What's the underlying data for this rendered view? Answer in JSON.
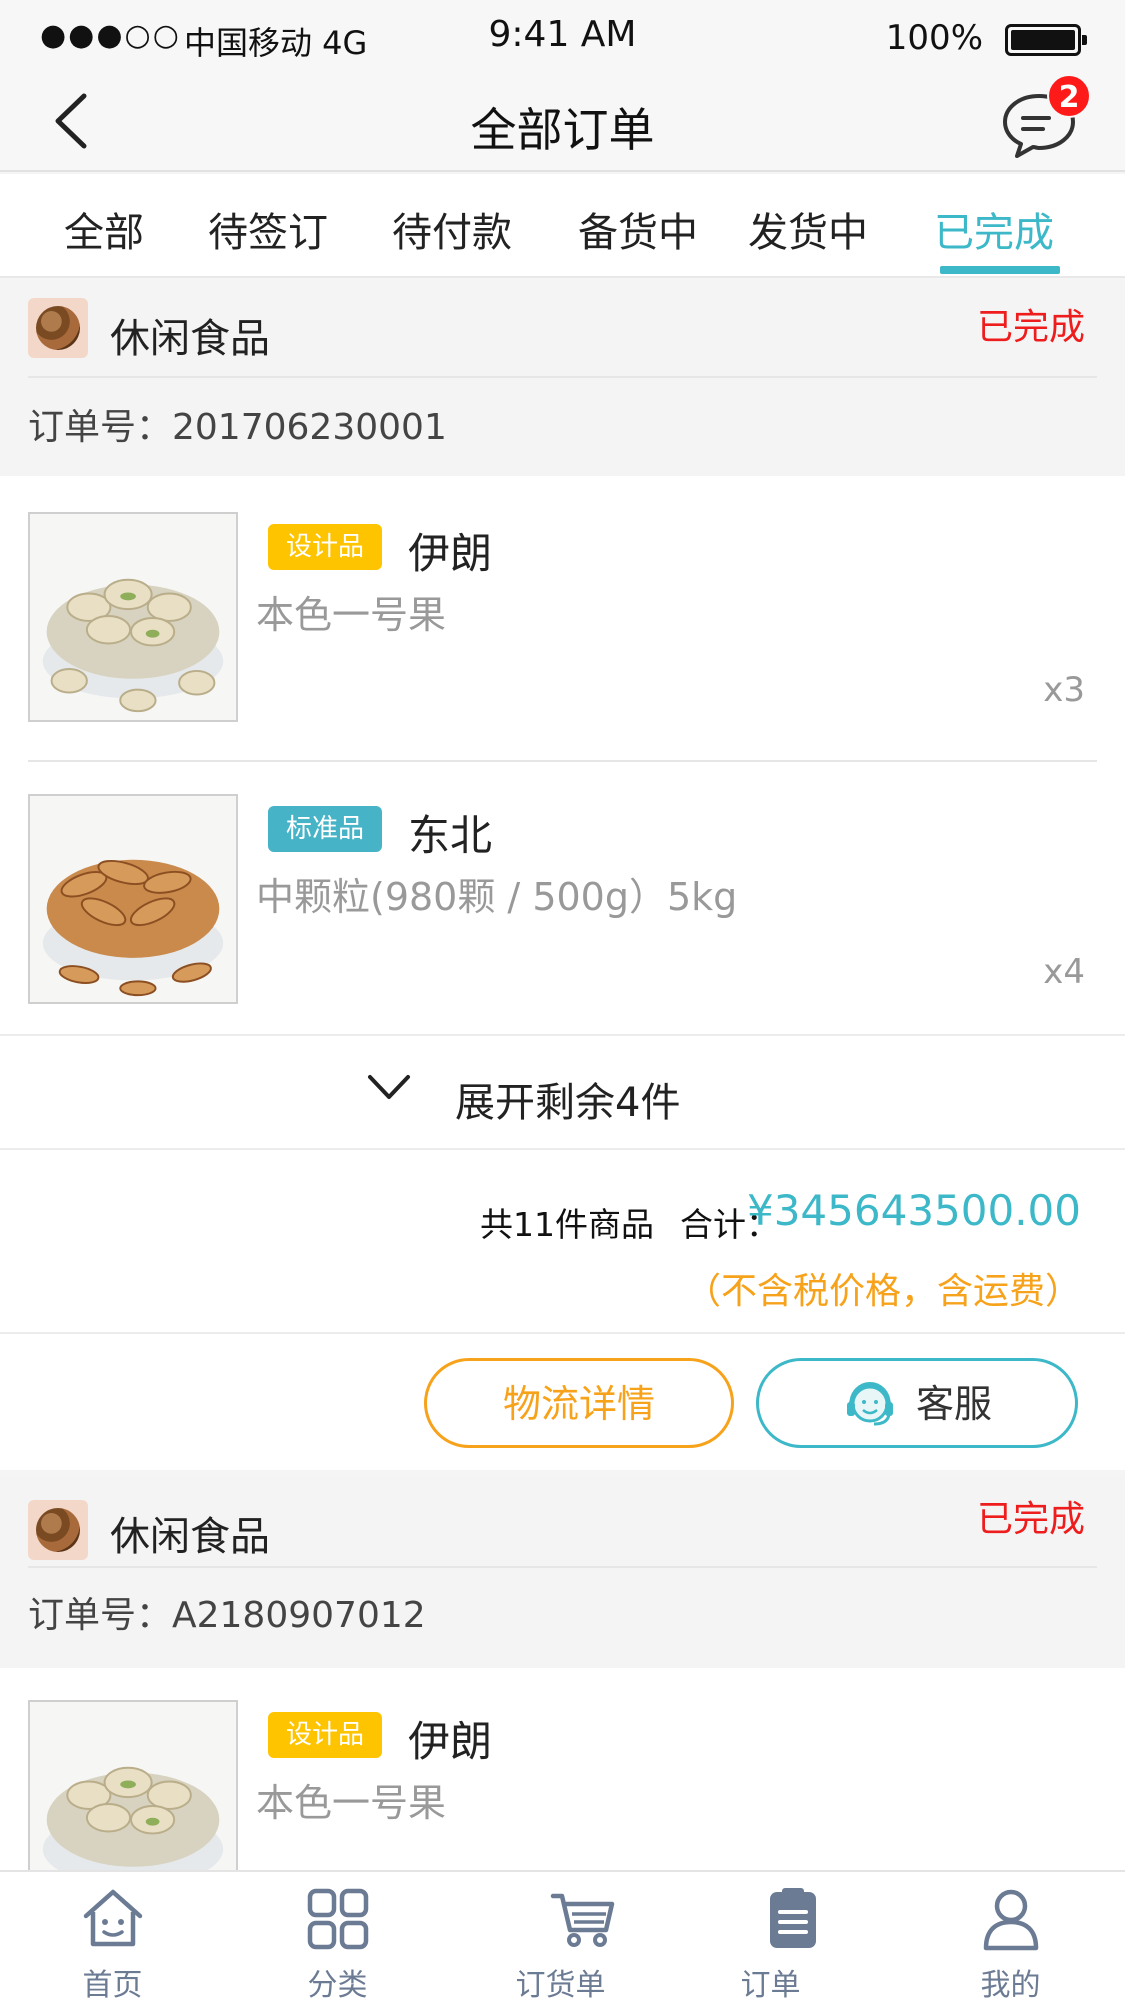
{
  "status_bar": {
    "signal": "●●●○○",
    "carrier": "中国移动 4G",
    "time": "9:41 AM",
    "battery": "100%"
  },
  "nav": {
    "title": "全部订单",
    "back_icon": "chevron-left-icon",
    "message_icon": "chat-icon",
    "message_badge": "2"
  },
  "tabs": [
    {
      "label": "全部",
      "active": false
    },
    {
      "label": "待签订",
      "active": false
    },
    {
      "label": "待付款",
      "active": false
    },
    {
      "label": "备货中",
      "active": false
    },
    {
      "label": "发货中",
      "active": false
    },
    {
      "label": "已完成",
      "active": true
    }
  ],
  "orders": [
    {
      "shop_name": "休闲食品",
      "status": "已完成",
      "order_no": "订单号：201706230001",
      "items": [
        {
          "tag": "设计品",
          "tag_type": "design",
          "name": "伊朗",
          "spec": "本色一号果",
          "qty": "x3",
          "image": "pistachio"
        },
        {
          "tag": "标准品",
          "tag_type": "standard",
          "name": "东北",
          "spec": "中颗粒(980颗 / 500g）5kg",
          "qty": "x4",
          "image": "almond"
        }
      ],
      "expand_label": "展开剩余4件",
      "count_text": "共11件商品",
      "total_label": "合计：",
      "total": "¥345643500.00",
      "note": "（不含税价格，含运费）",
      "buttons": {
        "logistics": "物流详情",
        "service": "客服"
      }
    },
    {
      "shop_name": "休闲食品",
      "status": "已完成",
      "order_no": "订单号：A2180907012",
      "items": [
        {
          "tag": "设计品",
          "tag_type": "design",
          "name": "伊朗",
          "spec": "本色一号果",
          "qty": "",
          "image": "pistachio"
        }
      ]
    }
  ],
  "tabbar": [
    {
      "label": "首页",
      "icon": "home-icon"
    },
    {
      "label": "分类",
      "icon": "category-icon"
    },
    {
      "label": "订货单",
      "icon": "cart-icon"
    },
    {
      "label": "订单",
      "icon": "order-icon"
    },
    {
      "label": "我的",
      "icon": "user-icon"
    }
  ],
  "colors": {
    "accent": "#3cb8c8",
    "status_red": "#ee1c1c",
    "orange": "#f7a21b",
    "tag_design": "#ffc400",
    "tag_standard": "#47b3c7",
    "tab_icon": "#6c7b94"
  }
}
